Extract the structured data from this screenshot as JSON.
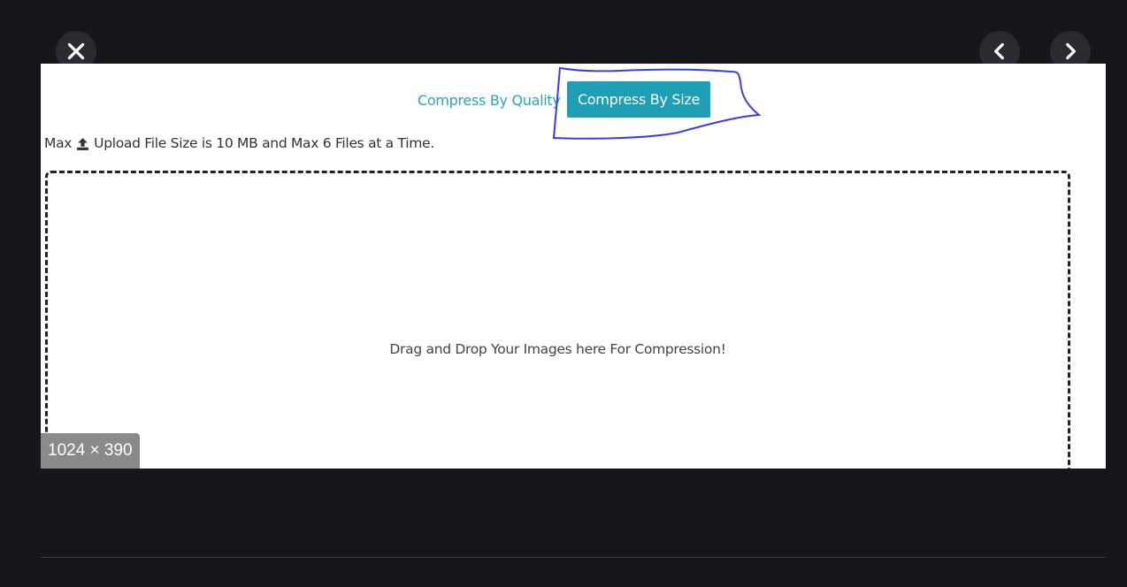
{
  "viewer": {
    "close_icon": "close-icon",
    "prev_icon": "chevron-left-icon",
    "next_icon": "chevron-right-icon",
    "dimensions_label": "1024 × 390"
  },
  "page": {
    "compress_by_quality_label": "Compress By Quality",
    "compress_by_size_label": "Compress By Size",
    "max_prefix": "Max",
    "upload_icon": "upload-icon",
    "max_note_text": "Upload File Size is 10 MB and Max 6 Files at a Time.",
    "dropzone_text": "Drag and Drop Your Images here For Compression!"
  },
  "colors": {
    "background": "#16171b",
    "link": "#2aa5c0",
    "button": "#1f9fb6",
    "annotation": "#3b3bea"
  }
}
